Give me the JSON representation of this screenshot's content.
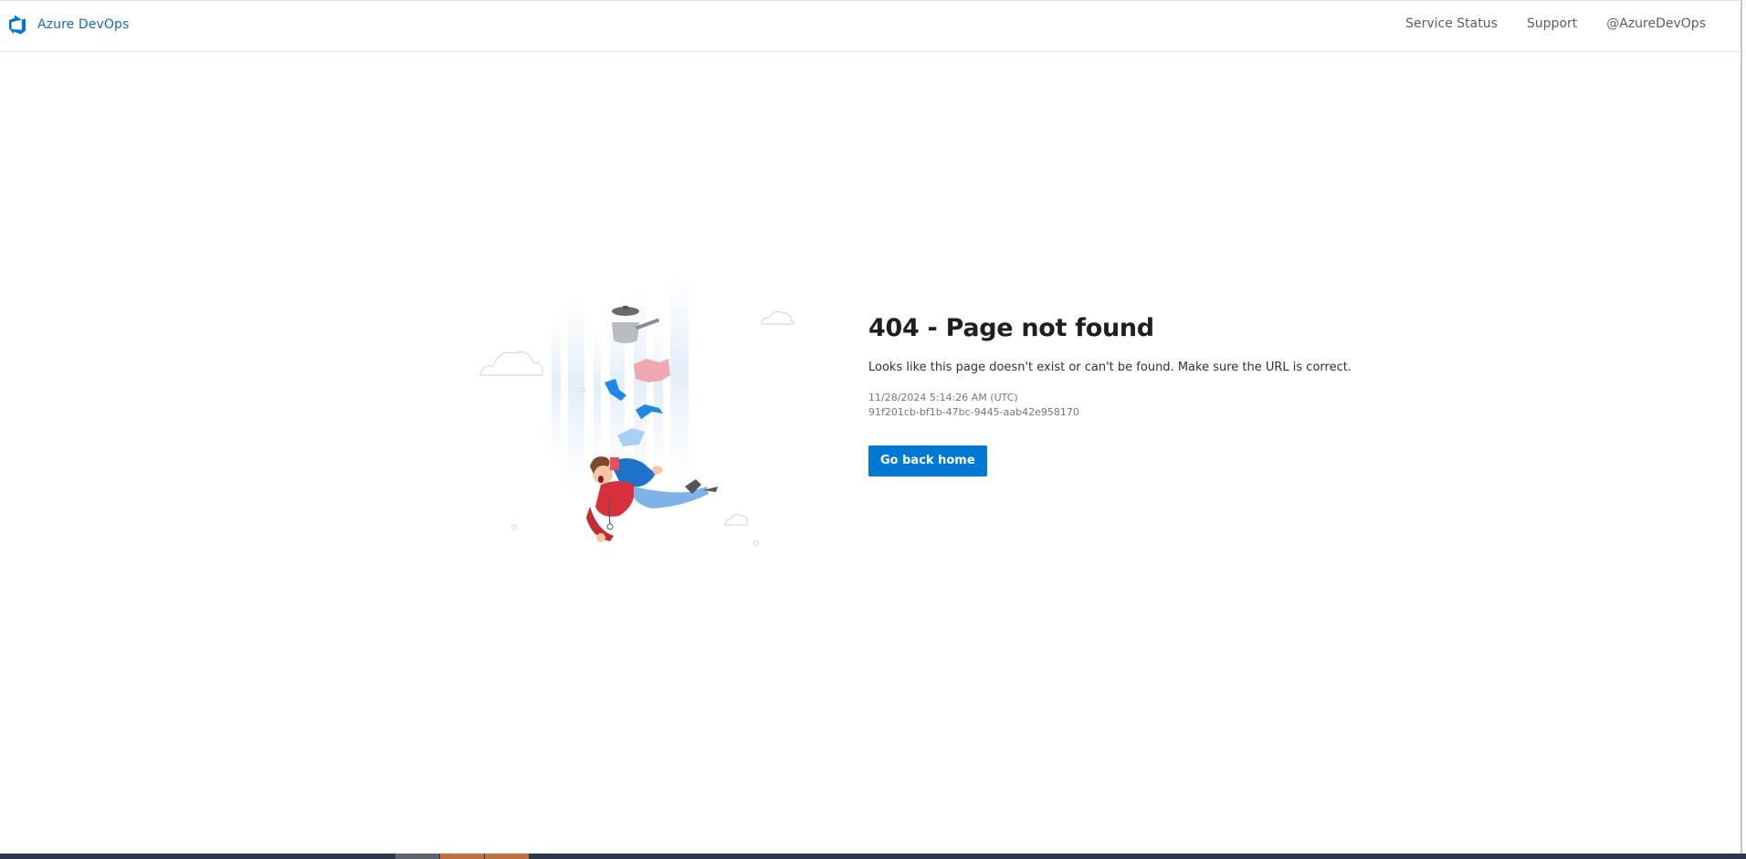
{
  "header": {
    "brand": "Azure DevOps",
    "nav": [
      "Service Status",
      "Support",
      "@AzureDevOps"
    ]
  },
  "error": {
    "title": "404 - Page not found",
    "message": "Looks like this page doesn't exist or can't be found. Make sure the URL is correct.",
    "timestamp": "11/28/2024 5:14:26 AM (UTC)",
    "activity_id": "91f201cb-bf1b-47bc-9445-aab42e958170",
    "button_label": "Go back home"
  },
  "colors": {
    "accent": "#0078d4",
    "brand_text": "#0f6cbd"
  },
  "icons": [
    "azure-devops-logo-icon",
    "falling-man-illustration"
  ]
}
